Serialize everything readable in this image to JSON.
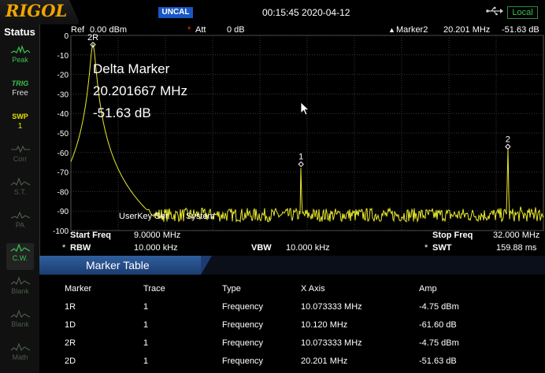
{
  "topbar": {
    "logo": "RIGOL",
    "uncal": "UNCAL",
    "datetime": "00:15:45 2020-04-12",
    "usb_icon": "usb-icon",
    "local": "Local"
  },
  "sidebar": {
    "title": "Status",
    "items": [
      {
        "name": "peak",
        "label": "Peak",
        "icon": "waveform-icon"
      },
      {
        "name": "trig",
        "top": "TRIG",
        "label": "Free"
      },
      {
        "name": "swp",
        "top": "SWP",
        "label": "1"
      },
      {
        "name": "corr",
        "label": "Corr",
        "icon": "corr-icon"
      },
      {
        "name": "st",
        "label": "S.T.",
        "icon": "wave-icon"
      },
      {
        "name": "pa",
        "label": "PA",
        "icon": "pa-icon"
      },
      {
        "name": "cw",
        "label": "C.W.",
        "icon": "wave-icon"
      },
      {
        "name": "blank1",
        "label": "Blank",
        "icon": "wave-icon"
      },
      {
        "name": "blank2",
        "label": "Blank",
        "icon": "wave-icon"
      },
      {
        "name": "math",
        "label": "Math",
        "icon": "wave-icon"
      }
    ]
  },
  "header": {
    "ref_label": "Ref",
    "ref_value": "0.00 dBm",
    "att_label": "Att",
    "att_value": "0 dB",
    "marker_label": "Marker2",
    "marker_freq": "20.201 MHz",
    "marker_amp": "-51.63 dB"
  },
  "delta": {
    "title": "Delta Marker",
    "freq": "20.201667 MHz",
    "amp": "-51.63 dB"
  },
  "overlay_text": {
    "userkey": "UserKey Set",
    "system": "System"
  },
  "chart_data": {
    "type": "line",
    "x_unit": "MHz",
    "xlim": [
      9.0,
      32.0
    ],
    "ylim": [
      -100,
      0
    ],
    "yticks": [
      0,
      -10,
      -20,
      -30,
      -40,
      -50,
      -60,
      -70,
      -80,
      -90,
      -100
    ],
    "ytick_labels": [
      "0",
      "-10",
      "-20",
      "-30",
      "-40",
      "-50",
      "-60",
      "-70",
      "-80",
      "-90",
      "-100"
    ],
    "grid": true,
    "noise_floor_dB": -92,
    "peaks": [
      {
        "x": 10.073333,
        "y": -4.75,
        "width": 0.25
      },
      {
        "x": 10.8,
        "y": -85,
        "width": 0.05
      },
      {
        "x": 11.5,
        "y": -79,
        "width": 0.06
      },
      {
        "x": 20.201,
        "y": -66,
        "width": 0.04
      },
      {
        "x": 30.27,
        "y": -57,
        "width": 0.04
      },
      {
        "x": 30.9,
        "y": -85,
        "width": 0.05
      },
      {
        "x": 31.6,
        "y": -83,
        "width": 0.05
      }
    ],
    "markers": [
      {
        "label": "2R",
        "x": 10.073333,
        "y": -4.75
      },
      {
        "label": "1",
        "x": 20.201,
        "y": -66
      },
      {
        "label": "2",
        "x": 30.27,
        "y": -57
      }
    ],
    "trace_color": "#e8e830",
    "grid_color": "#3a3a3a"
  },
  "footer": {
    "start_label": "Start Freq",
    "start_value": "9.0000 MHz",
    "stop_label": "Stop Freq",
    "stop_value": "32.000 MHz",
    "rbw_label": "RBW",
    "rbw_value": "10.000 kHz",
    "vbw_label": "VBW",
    "vbw_value": "10.000 kHz",
    "swt_label": "SWT",
    "swt_value": "159.88 ms"
  },
  "marker_table": {
    "title": "Marker Table",
    "headers": [
      "Marker",
      "Trace",
      "Type",
      "X Axis",
      "Amp"
    ],
    "rows": [
      [
        "1R",
        "1",
        "Frequency",
        "10.073333 MHz",
        "-4.75 dBm"
      ],
      [
        "1D",
        "1",
        "Frequency",
        "10.120 MHz",
        "-61.60 dB"
      ],
      [
        "2R",
        "1",
        "Frequency",
        "10.073333 MHz",
        "-4.75 dBm"
      ],
      [
        "2D",
        "1",
        "Frequency",
        "20.201 MHz",
        "-51.63 dB"
      ]
    ]
  }
}
